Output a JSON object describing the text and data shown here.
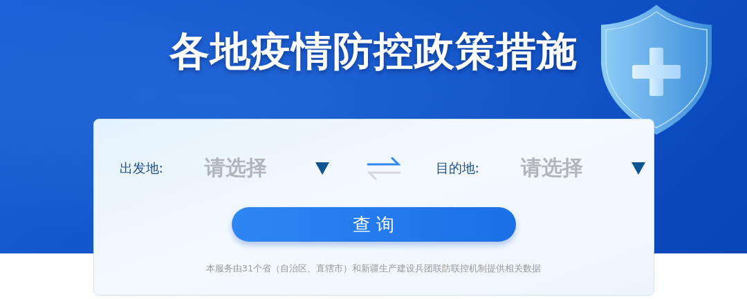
{
  "title": "各地疫情防控政策措施",
  "fields": [
    {
      "label": "出发地:",
      "placeholder": "请选择"
    },
    {
      "label": "目的地:",
      "placeholder": "请选择"
    }
  ],
  "query_button": "查 询",
  "footnote": "本服务由31个省（自治区、直辖市）和新疆生产建设兵团联防联控机制提供相关数据"
}
